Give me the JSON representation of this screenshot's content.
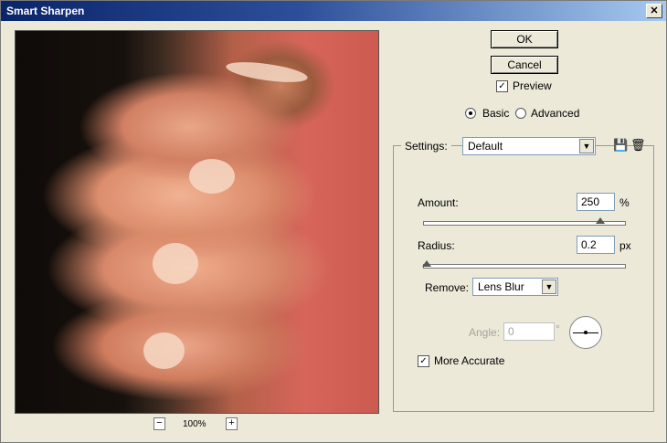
{
  "window": {
    "title": "Smart Sharpen",
    "close_glyph": "✕"
  },
  "preview": {
    "zoom_level": "100%",
    "zoom_out": "−",
    "zoom_in": "+"
  },
  "buttons": {
    "ok": "OK",
    "cancel": "Cancel"
  },
  "preview_checkbox": {
    "label": "Preview",
    "checked": true
  },
  "mode": {
    "basic": "Basic",
    "advanced": "Advanced",
    "selected": "Basic"
  },
  "settings": {
    "label": "Settings:",
    "value": "Default",
    "save_icon": "save-settings-icon",
    "delete_icon": "trash-icon"
  },
  "amount": {
    "label": "Amount:",
    "value": "250",
    "unit": "%",
    "slider_fraction": 0.88
  },
  "radius": {
    "label": "Radius:",
    "value": "0.2",
    "unit": "px",
    "slider_fraction": 0.0
  },
  "remove": {
    "label": "Remove:",
    "value": "Lens Blur"
  },
  "angle": {
    "label": "Angle:",
    "value": "0",
    "unit": "°"
  },
  "more_accurate": {
    "label": "More Accurate",
    "checked": true
  }
}
